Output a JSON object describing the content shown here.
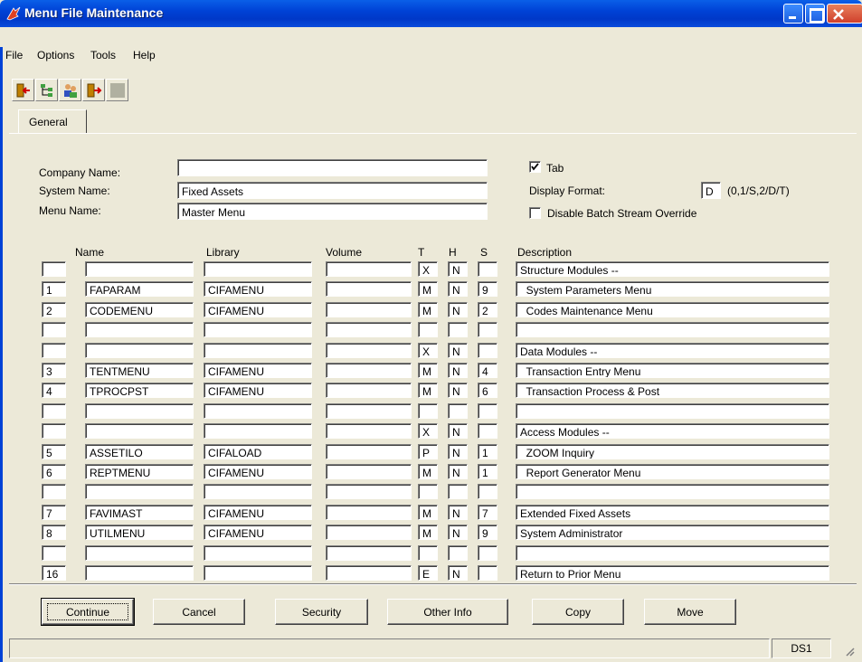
{
  "window": {
    "title": "Menu File Maintenance"
  },
  "menubar": {
    "items": [
      "File",
      "Options",
      "Tools",
      "Help"
    ]
  },
  "toolbar": {
    "icons": [
      "exit-icon",
      "tree-icon",
      "users-icon",
      "door-icon",
      "blank-icon"
    ]
  },
  "tab": {
    "label": "General"
  },
  "header": {
    "company_label": "Company Name:",
    "company_value": "",
    "system_label": "System Name:",
    "system_value": "Fixed Assets",
    "menu_label": "Menu Name:",
    "menu_value": "Master Menu",
    "tab_checkbox_label": "Tab",
    "tab_checked": true,
    "display_format_label": "Display Format:",
    "display_format_value": "D",
    "display_format_hint": "(0,1/S,2/D/T)",
    "disable_batch_label": "Disable Batch Stream Override",
    "disable_batch_checked": false
  },
  "grid": {
    "headers": {
      "name": "Name",
      "library": "Library",
      "volume": "Volume",
      "t": "T",
      "h": "H",
      "s": "S",
      "description": "Description"
    },
    "rows": [
      {
        "num": "",
        "name": "",
        "library": "",
        "volume": "",
        "t": "X",
        "h": "N",
        "s": "",
        "description": "Structure Modules --"
      },
      {
        "num": "1",
        "name": "FAPARAM",
        "library": "CIFAMENU",
        "volume": "",
        "t": "M",
        "h": "N",
        "s": "9",
        "description": "  System Parameters Menu"
      },
      {
        "num": "2",
        "name": "CODEMENU",
        "library": "CIFAMENU",
        "volume": "",
        "t": "M",
        "h": "N",
        "s": "2",
        "description": "  Codes Maintenance Menu"
      },
      {
        "num": "",
        "name": "",
        "library": "",
        "volume": "",
        "t": "",
        "h": "",
        "s": "",
        "description": ""
      },
      {
        "num": "",
        "name": "",
        "library": "",
        "volume": "",
        "t": "X",
        "h": "N",
        "s": "",
        "description": "Data Modules --"
      },
      {
        "num": "3",
        "name": "TENTMENU",
        "library": "CIFAMENU",
        "volume": "",
        "t": "M",
        "h": "N",
        "s": "4",
        "description": "  Transaction Entry Menu"
      },
      {
        "num": "4",
        "name": "TPROCPST",
        "library": "CIFAMENU",
        "volume": "",
        "t": "M",
        "h": "N",
        "s": "6",
        "description": "  Transaction Process & Post"
      },
      {
        "num": "",
        "name": "",
        "library": "",
        "volume": "",
        "t": "",
        "h": "",
        "s": "",
        "description": ""
      },
      {
        "num": "",
        "name": "",
        "library": "",
        "volume": "",
        "t": "X",
        "h": "N",
        "s": "",
        "description": "Access Modules --"
      },
      {
        "num": "5",
        "name": "ASSETILO",
        "library": "CIFALOAD",
        "volume": "",
        "t": "P",
        "h": "N",
        "s": "1",
        "description": "  ZOOM Inquiry"
      },
      {
        "num": "6",
        "name": "REPTMENU",
        "library": "CIFAMENU",
        "volume": "",
        "t": "M",
        "h": "N",
        "s": "1",
        "description": "  Report Generator Menu"
      },
      {
        "num": "",
        "name": "",
        "library": "",
        "volume": "",
        "t": "",
        "h": "",
        "s": "",
        "description": ""
      },
      {
        "num": "7",
        "name": "FAVIMAST",
        "library": "CIFAMENU",
        "volume": "",
        "t": "M",
        "h": "N",
        "s": "7",
        "description": "Extended Fixed Assets"
      },
      {
        "num": "8",
        "name": "UTILMENU",
        "library": "CIFAMENU",
        "volume": "",
        "t": "M",
        "h": "N",
        "s": "9",
        "description": "System Administrator"
      },
      {
        "num": "",
        "name": "",
        "library": "",
        "volume": "",
        "t": "",
        "h": "",
        "s": "",
        "description": ""
      },
      {
        "num": "16",
        "name": "",
        "library": "",
        "volume": "",
        "t": "E",
        "h": "N",
        "s": "",
        "description": "Return to Prior Menu"
      }
    ]
  },
  "buttons": {
    "continue": "Continue",
    "cancel": "Cancel",
    "security": "Security",
    "other_info": "Other Info",
    "copy": "Copy",
    "move": "Move"
  },
  "status": {
    "pane": "DS1"
  }
}
